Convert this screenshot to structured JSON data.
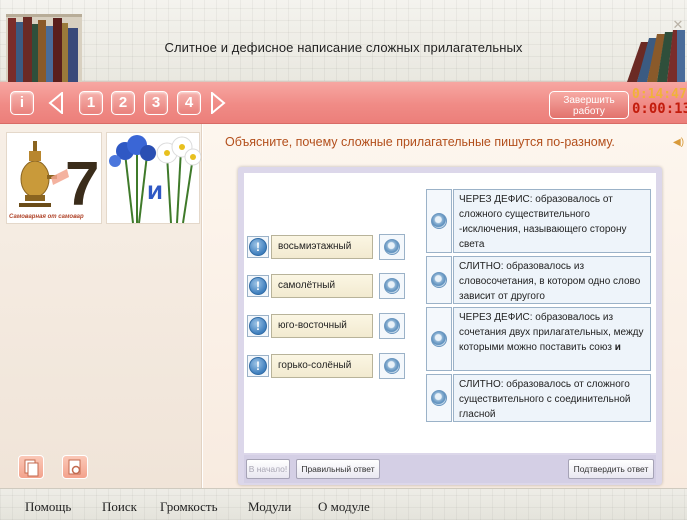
{
  "header": {
    "title": "Слитное и дефисное написание сложных прилагательных"
  },
  "toolbar": {
    "info_label": "i",
    "pages": [
      "1",
      "2",
      "3",
      "4"
    ],
    "finish_label_line1": "Завершить",
    "finish_label_line2": "работу",
    "timer_total": "0:14:47",
    "timer_elapsed": "0:00:13"
  },
  "left_panel": {
    "thumb1_caption": "Самоварная от самовар",
    "thumb1_digit": "7",
    "thumb2_letter": "и"
  },
  "main": {
    "instruction": "Объясните, почему сложные прилагательные пишутся по-разному.",
    "words": [
      {
        "mark": "!",
        "text": "восьмиэтажный"
      },
      {
        "mark": "!",
        "text": "самолётный"
      },
      {
        "mark": "!",
        "text": "юго-восточный"
      },
      {
        "mark": "!",
        "text": "горько-солёный"
      }
    ],
    "definitions": [
      {
        "text": "ЧЕРЕЗ ДЕФИС: образовалось от сложного существительного -исключения, называющего сторону света"
      },
      {
        "text": "СЛИТНО: образовалось из словосочетания, в котором одно слово зависит от другого"
      },
      {
        "text": "ЧЕРЕЗ ДЕФИС: образовалось из сочетания двух прилагательных, между которыми можно поставить союз",
        "emphasis": "и"
      },
      {
        "text": "СЛИТНО: образовалось от сложного существительного с соединительной гласной"
      }
    ],
    "buttons": {
      "restart": "В начало!",
      "correct_answer": "Правильный ответ",
      "confirm": "Подтвердить ответ"
    }
  },
  "menubar": {
    "items": [
      "Помощь",
      "Поиск",
      "Громкость",
      "Модули",
      "О модуле"
    ]
  },
  "colors": {
    "toolbar": "#f08b86",
    "instruction": "#b34f1c",
    "timer_total": "#f0b23a",
    "timer_elapsed": "#c31c0c",
    "accent_blue": "#3f7fbe"
  }
}
